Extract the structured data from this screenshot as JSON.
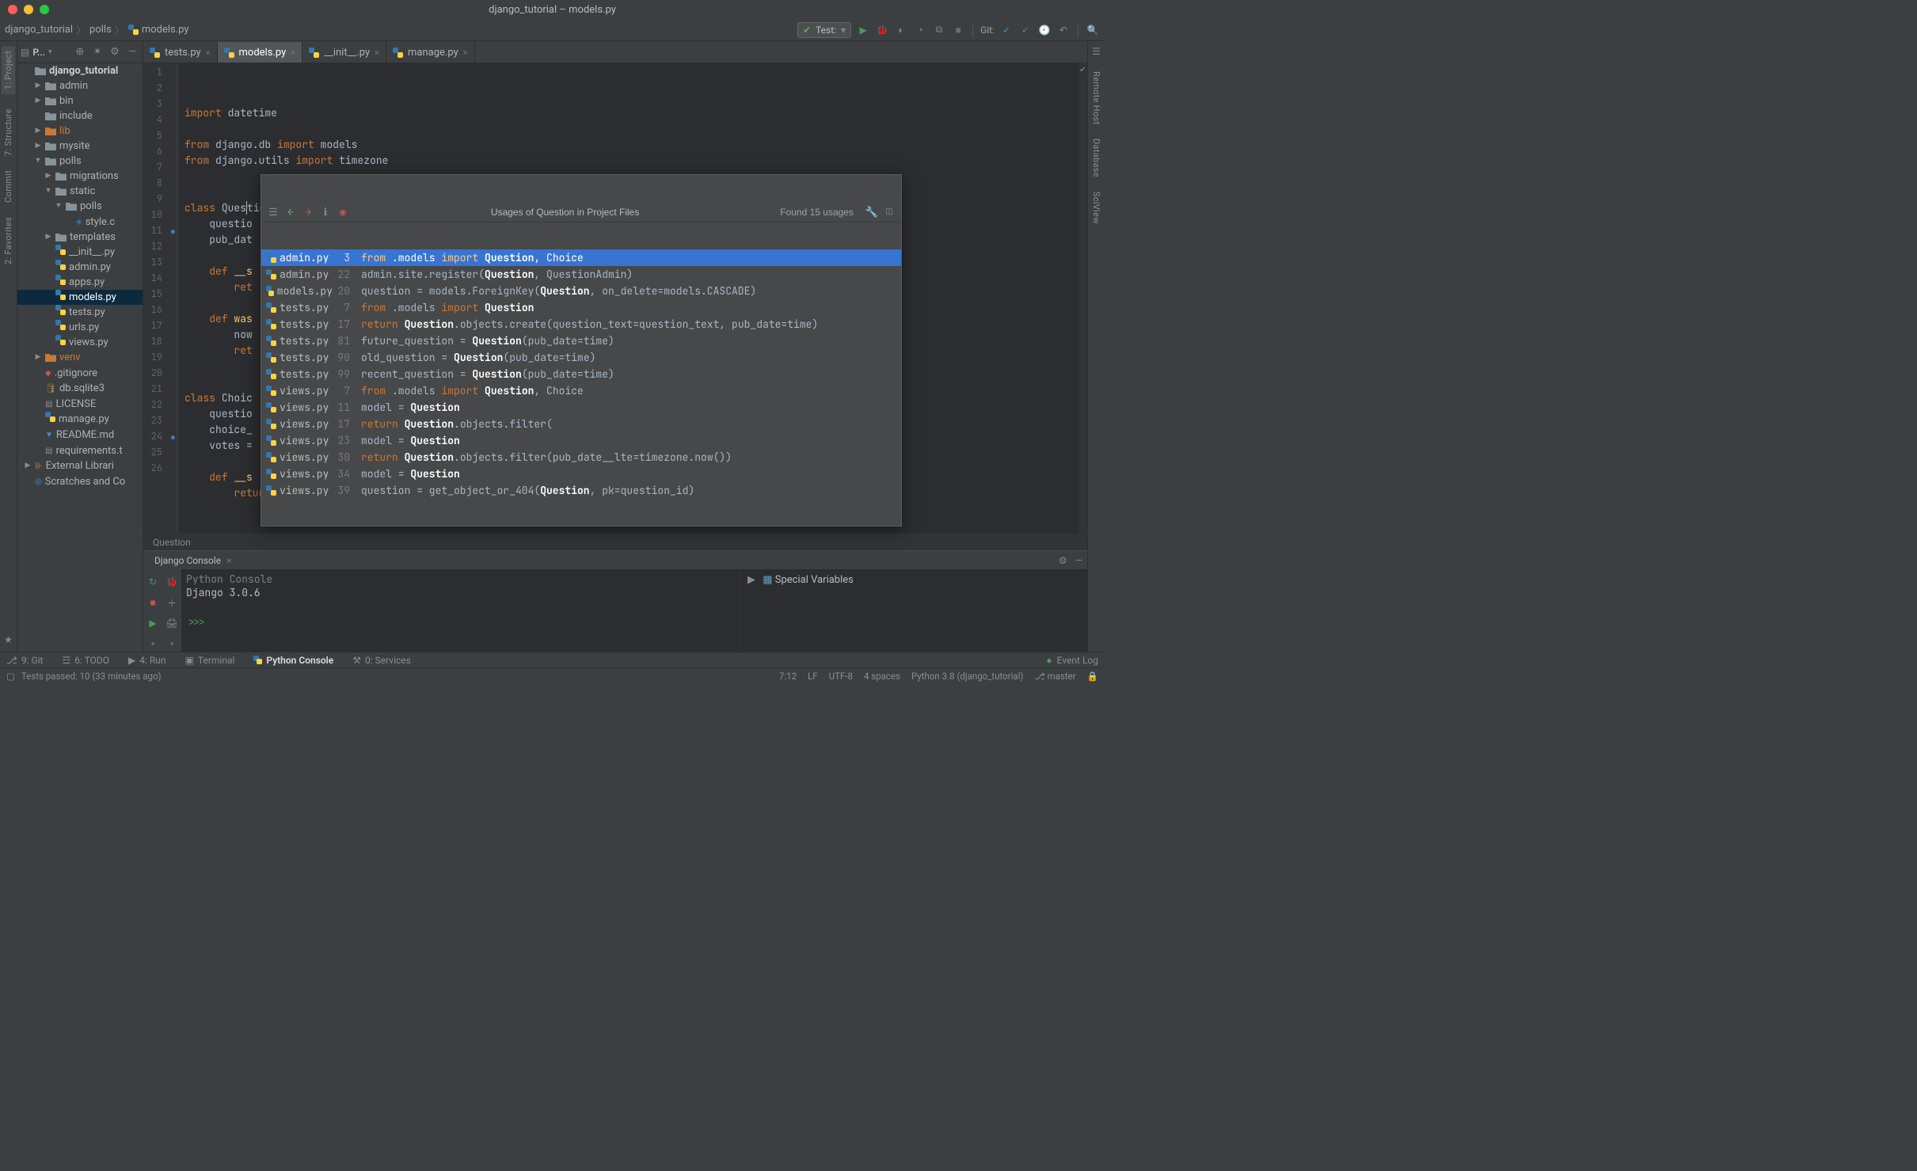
{
  "title": "django_tutorial – models.py",
  "breadcrumb": {
    "root": "django_tutorial",
    "mid": "polls",
    "file": "models.py"
  },
  "runConfig": {
    "icon": "✓",
    "label": "Test:"
  },
  "gitLabel": "Git:",
  "projectLabel": "P...",
  "leftRail": [
    {
      "label": "1: Project",
      "active": true
    },
    {
      "label": "7: Structure",
      "active": false
    },
    {
      "label": "Commit",
      "active": false
    },
    {
      "label": "2: Favorites",
      "active": false
    }
  ],
  "rightRail": [
    {
      "label": "Remote Host"
    },
    {
      "label": "Database"
    },
    {
      "label": "SciView"
    }
  ],
  "tree": [
    {
      "depth": 0,
      "arrow": "",
      "icon": "folder-root",
      "name": "django_tutorial",
      "bold": true
    },
    {
      "depth": 1,
      "arrow": "▶",
      "icon": "folder",
      "name": "admin"
    },
    {
      "depth": 1,
      "arrow": "▶",
      "icon": "folder",
      "name": "bin"
    },
    {
      "depth": 1,
      "arrow": "",
      "icon": "folder",
      "name": "include"
    },
    {
      "depth": 1,
      "arrow": "▶",
      "icon": "folder-lib",
      "name": "lib",
      "lib": true
    },
    {
      "depth": 1,
      "arrow": "▶",
      "icon": "folder",
      "name": "mysite"
    },
    {
      "depth": 1,
      "arrow": "▼",
      "icon": "folder",
      "name": "polls"
    },
    {
      "depth": 2,
      "arrow": "▶",
      "icon": "folder",
      "name": "migrations"
    },
    {
      "depth": 2,
      "arrow": "▼",
      "icon": "folder",
      "name": "static"
    },
    {
      "depth": 3,
      "arrow": "▼",
      "icon": "folder",
      "name": "polls"
    },
    {
      "depth": 4,
      "arrow": "",
      "icon": "css",
      "name": "style.css",
      "cut": "style.c"
    },
    {
      "depth": 2,
      "arrow": "▶",
      "icon": "folder",
      "name": "templates"
    },
    {
      "depth": 2,
      "arrow": "",
      "icon": "py",
      "name": "__init__.py"
    },
    {
      "depth": 2,
      "arrow": "",
      "icon": "py",
      "name": "admin.py"
    },
    {
      "depth": 2,
      "arrow": "",
      "icon": "py",
      "name": "apps.py"
    },
    {
      "depth": 2,
      "arrow": "",
      "icon": "py",
      "name": "models.py",
      "sel": true
    },
    {
      "depth": 2,
      "arrow": "",
      "icon": "py",
      "name": "tests.py"
    },
    {
      "depth": 2,
      "arrow": "",
      "icon": "py",
      "name": "urls.py"
    },
    {
      "depth": 2,
      "arrow": "",
      "icon": "py",
      "name": "views.py"
    },
    {
      "depth": 1,
      "arrow": "▶",
      "icon": "folder-venv",
      "name": "venv",
      "venv": true
    },
    {
      "depth": 1,
      "arrow": "",
      "icon": "gitignore",
      "name": ".gitignore"
    },
    {
      "depth": 1,
      "arrow": "",
      "icon": "db",
      "name": "db.sqlite3"
    },
    {
      "depth": 1,
      "arrow": "",
      "icon": "txt",
      "name": "LICENSE"
    },
    {
      "depth": 1,
      "arrow": "",
      "icon": "py",
      "name": "manage.py"
    },
    {
      "depth": 1,
      "arrow": "",
      "icon": "md",
      "name": "README.md"
    },
    {
      "depth": 1,
      "arrow": "",
      "icon": "txt",
      "name": "requirements.t",
      "cut": "requirements.t"
    },
    {
      "depth": 0,
      "arrow": "▶",
      "icon": "lib-ext",
      "name": "External Librari",
      "cut": "External Librari"
    },
    {
      "depth": 0,
      "arrow": "",
      "icon": "scratch",
      "name": "Scratches and Co",
      "cut": "Scratches and Co"
    }
  ],
  "tabs": [
    {
      "name": "tests.py",
      "active": false
    },
    {
      "name": "models.py",
      "active": true
    },
    {
      "name": "__init__.py",
      "active": false
    },
    {
      "name": "manage.py",
      "active": false
    }
  ],
  "code": [
    {
      "n": 1,
      "html": "<span class='kw'>import</span> <span class='ident'>datetime</span>"
    },
    {
      "n": 2,
      "html": ""
    },
    {
      "n": 3,
      "html": "<span class='kw'>from</span> <span class='ident'>django.db</span> <span class='kw'>import</span> <span class='ident'>models</span>"
    },
    {
      "n": 4,
      "html": "<span class='kw'>from</span> <span class='ident'>django.utils</span> <span class='kw'>import</span> <span class='ident'>timezone</span>"
    },
    {
      "n": 5,
      "html": ""
    },
    {
      "n": 6,
      "html": ""
    },
    {
      "n": 7,
      "html": "<span class='kw'>class</span> <span class='cls'>Ques<span style=\"border-left:1px solid #bbb;\">t</span>ion</span>(models.Model):",
      "fold": true
    },
    {
      "n": 8,
      "html": "    questio"
    },
    {
      "n": 9,
      "html": "    pub_dat"
    },
    {
      "n": 10,
      "html": ""
    },
    {
      "n": 11,
      "html": "    <span class='kw'>def</span> <span class='func'>__s</span>",
      "mark": "↗"
    },
    {
      "n": 12,
      "html": "        <span class='kw'>ret</span>"
    },
    {
      "n": 13,
      "html": ""
    },
    {
      "n": 14,
      "html": "    <span class='kw'>def</span> <span class='func'>was</span>"
    },
    {
      "n": 15,
      "html": "        now"
    },
    {
      "n": 16,
      "html": "        <span class='kw'>ret</span>"
    },
    {
      "n": 17,
      "html": ""
    },
    {
      "n": 18,
      "html": ""
    },
    {
      "n": 19,
      "html": "<span class='kw'>class</span> <span class='cls'>Choic</span>",
      "fold": true
    },
    {
      "n": 20,
      "html": "    questio"
    },
    {
      "n": 21,
      "html": "    choice_"
    },
    {
      "n": 22,
      "html": "    votes ="
    },
    {
      "n": 23,
      "html": ""
    },
    {
      "n": 24,
      "html": "    <span class='kw'>def</span> <span class='func'>__s</span>",
      "mark": "↗"
    },
    {
      "n": 25,
      "html": "        <span class='kw'>return</span> <span class='self'>self</span>.choice_text"
    },
    {
      "n": 26,
      "html": ""
    }
  ],
  "editorBreadcrumb": "Question",
  "popup": {
    "title": "Usages of Question in Project Files",
    "found": "Found 15 usages",
    "rows": [
      {
        "file": "admin.py",
        "ln": 3,
        "sel": true,
        "html": "<span class='kw2'>from</span> .models <span class='kw2'>import</span> <span class='hl'>Question</span>, Choice"
      },
      {
        "file": "admin.py",
        "ln": 22,
        "html": "admin.site.register(<span class='hl'>Question</span>, QuestionAdmin)"
      },
      {
        "file": "models.py",
        "ln": 20,
        "html": "question = models.ForeignKey(<span class='hl'>Question</span>, on_delete=models.CASCADE)"
      },
      {
        "file": "tests.py",
        "ln": 7,
        "html": "<span class='kw2'>from</span> .models <span class='kw2'>import</span> <span class='hl'>Question</span>"
      },
      {
        "file": "tests.py",
        "ln": 17,
        "html": "<span class='kw2'>return</span> <span class='hl'>Question</span>.objects.create(question_text=question_text, pub_date=time)"
      },
      {
        "file": "tests.py",
        "ln": 81,
        "html": "future_question = <span class='hl'>Question</span>(pub_date=time)"
      },
      {
        "file": "tests.py",
        "ln": 90,
        "html": "old_question = <span class='hl'>Question</span>(pub_date=time)"
      },
      {
        "file": "tests.py",
        "ln": 99,
        "html": "recent_question = <span class='hl'>Question</span>(pub_date=time)"
      },
      {
        "file": "views.py",
        "ln": 7,
        "html": "<span class='kw2'>from</span> .models <span class='kw2'>import</span> <span class='hl'>Question</span>, Choice"
      },
      {
        "file": "views.py",
        "ln": 11,
        "html": "model = <span class='hl'>Question</span>"
      },
      {
        "file": "views.py",
        "ln": 17,
        "html": "<span class='kw2'>return</span> <span class='hl'>Question</span>.objects.filter("
      },
      {
        "file": "views.py",
        "ln": 23,
        "html": "model = <span class='hl'>Question</span>"
      },
      {
        "file": "views.py",
        "ln": 30,
        "html": "<span class='kw2'>return</span> <span class='hl'>Question</span>.objects.filter(pub_date__lte=timezone.now())"
      },
      {
        "file": "views.py",
        "ln": 34,
        "html": "model = <span class='hl'>Question</span>"
      },
      {
        "file": "views.py",
        "ln": 39,
        "html": "question = get_object_or_404(<span class='hl'>Question</span>, pk=question_id)"
      }
    ]
  },
  "console": {
    "tab": "Django Console",
    "header": "Python Console",
    "version": "Django 3.0.6",
    "prompt": ">>>",
    "specialVars": "Special Variables"
  },
  "toolWindows": {
    "git": "9: Git",
    "todo": "6: TODO",
    "run": "4: Run",
    "terminal": "Terminal",
    "pyconsole": "Python Console",
    "services": "0: Services",
    "eventlog": "Event Log"
  },
  "status": {
    "tests": "Tests passed: 10 (33 minutes ago)",
    "pos": "7:12",
    "le": "LF",
    "enc": "UTF-8",
    "indent": "4 spaces",
    "interp": "Python 3.8 (django_tutorial)",
    "branch": "master"
  }
}
